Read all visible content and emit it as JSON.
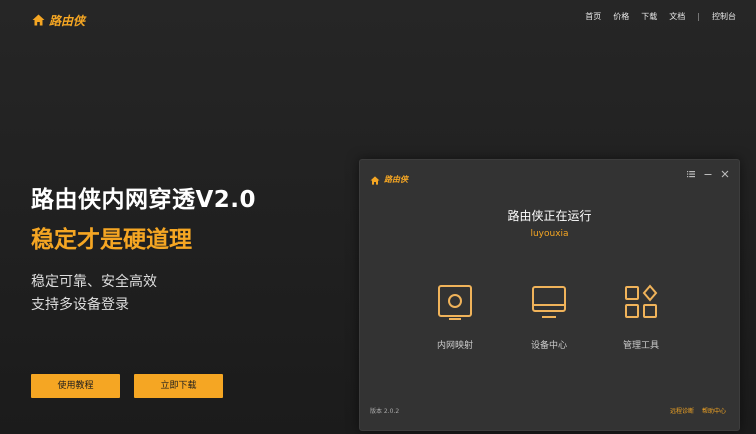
{
  "brand": {
    "name": "路由侠"
  },
  "nav": {
    "items": [
      "首页",
      "价格",
      "下载",
      "文档"
    ],
    "separator": "|",
    "console": "控制台"
  },
  "hero": {
    "title": "路由侠内网穿透V2.0",
    "subtitle": "稳定才是硬道理",
    "features": [
      "稳定可靠、安全高效",
      "支持多设备登录"
    ],
    "buttons": {
      "tutorial": "使用教程",
      "download": "立即下载"
    }
  },
  "app": {
    "brand": "路由侠",
    "status": "路由侠正在运行",
    "username": "luyouxia",
    "tools": [
      "内网映射",
      "设备中心",
      "管理工具"
    ],
    "version": "版本 2.0.2",
    "links": [
      "远程诊断",
      "帮助中心"
    ]
  },
  "colors": {
    "accent": "#f5a623",
    "background": "#1e1e1e",
    "window": "#333333"
  }
}
